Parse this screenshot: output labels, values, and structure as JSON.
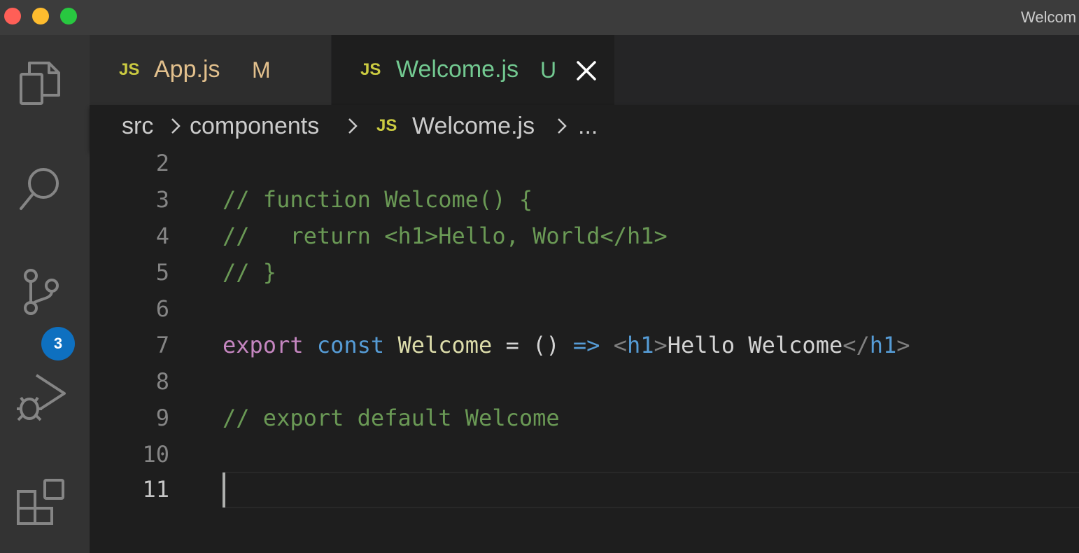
{
  "window": {
    "title": "Welcom"
  },
  "activity_bar": {
    "icons": [
      "explorer-icon",
      "search-icon",
      "source-control-icon",
      "run-debug-icon",
      "extensions-icon"
    ],
    "source_control_badge": "3"
  },
  "tabs": [
    {
      "icon_text": "JS",
      "label": "App.js",
      "status": "M",
      "label_color": "#e2c08d",
      "status_color": "#e2c08d",
      "active": false
    },
    {
      "icon_text": "JS",
      "label": "Welcome.js",
      "status": "U",
      "label_color": "#73c991",
      "status_color": "#73c991",
      "active": true
    }
  ],
  "breadcrumb": {
    "items": [
      "src",
      "components",
      "Welcome.js",
      "..."
    ],
    "file_icon_text": "JS"
  },
  "editor": {
    "line_numbers": [
      "2",
      "3",
      "4",
      "5",
      "6",
      "7",
      "8",
      "9",
      "10",
      "11"
    ],
    "current_line": "11",
    "lines": {
      "l3": "// function Welcome() {",
      "l4": "//   return <h1>Hello, World</h1>",
      "l5": "// }",
      "l7": {
        "kw_export": "export",
        "kw_const": "const",
        "name": "Welcome",
        "eq": " = ",
        "parens": "()",
        "arrow": "=>",
        "open_lt": "<",
        "open_tag": "h1",
        "open_gt": ">",
        "text": "Hello Welcome",
        "close_lt": "</",
        "close_tag": "h1",
        "close_gt": ">"
      },
      "l9": "// export default Welcome"
    }
  },
  "colors": {
    "js_icon": "#cbcb41",
    "badge": "#0e70c0",
    "comment": "#6a9955",
    "keyword": "#c586c0",
    "storage": "#569cd6",
    "function": "#dcdcaa"
  }
}
